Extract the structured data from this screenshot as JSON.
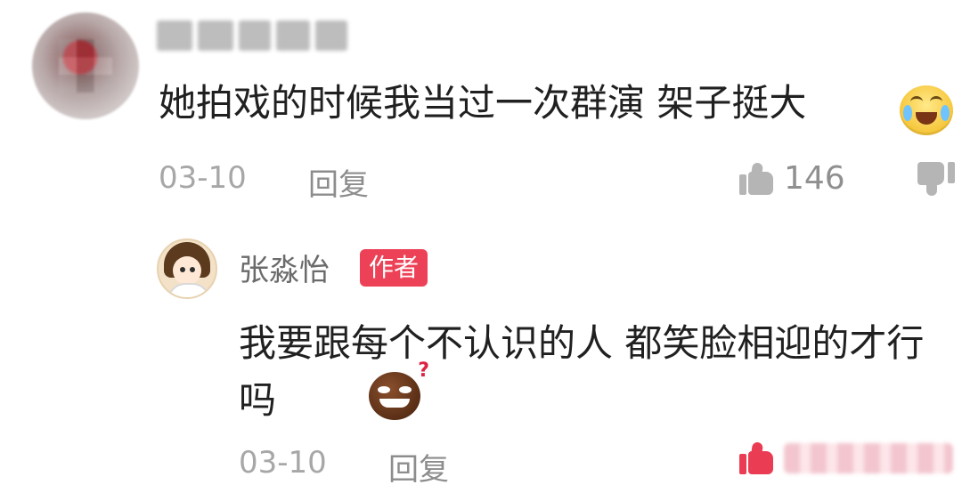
{
  "top_comment": {
    "text": "她拍戏的时候我当过一次群演 架子挺大",
    "emoji": "laughing-crying-emoji",
    "date": "03-10",
    "reply_label": "回复",
    "likes": "146"
  },
  "reply_comment": {
    "author": "张淼怡",
    "badge": "作者",
    "text": "我要跟每个不认识的人 都笑脸相迎的才行吗",
    "emoji": "sly-question-emoji",
    "date": "03-10",
    "reply_label": "回复"
  },
  "colors": {
    "badge_bg": "#ec4156",
    "meta_text": "#a7a7a7",
    "like_active": "#ea3d53"
  }
}
